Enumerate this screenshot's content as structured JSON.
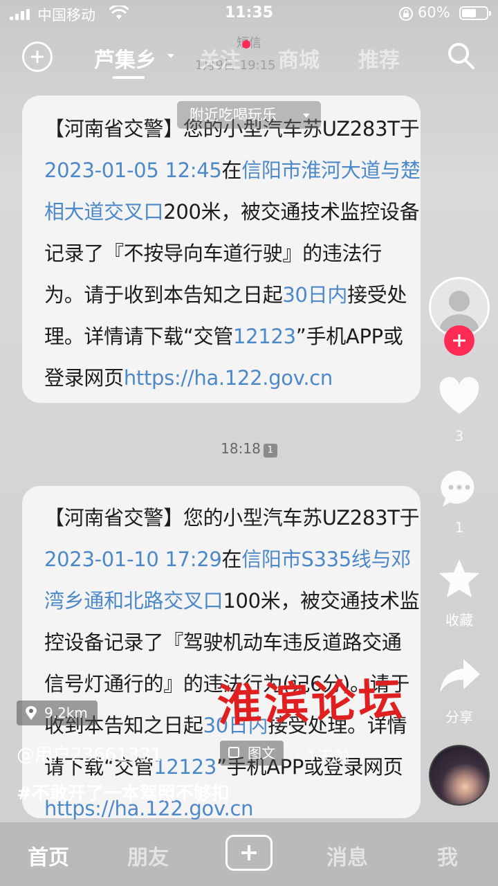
{
  "status_bar": {
    "carrier": "中国移动",
    "time": "11:35",
    "battery_pct": "60%",
    "battery_level": 0.6
  },
  "top_nav": {
    "location_tab": "芦集乡",
    "tabs": [
      "关注",
      "商城",
      "推荐"
    ]
  },
  "sms_header": {
    "title": "短信",
    "date": "1月9日 19:15"
  },
  "nearby_pill": "附近吃喝玩乐",
  "message1": {
    "parts": [
      {
        "text": "【河南省交警】您的小型汽车苏UZ283T于",
        "link": false
      },
      {
        "text": "2023-01-05 12:45",
        "link": true
      },
      {
        "text": "在",
        "link": false
      },
      {
        "text": "信阳市淮河大道与楚相大道交叉口",
        "link": true
      },
      {
        "text": "200米，被交通技术监控设备记录了『不按导向车道行驶』的违法行为。请于收到本告知之日起",
        "link": false
      },
      {
        "text": "30日内",
        "link": true
      },
      {
        "text": "接受处理。详情请下载“交管",
        "link": false
      },
      {
        "text": "12123",
        "link": true
      },
      {
        "text": "”手机APP或登录网页",
        "link": false
      },
      {
        "text": "https://ha.122.gov.cn",
        "link": true
      }
    ]
  },
  "timestamp": "18:18",
  "sim_badge": "1",
  "message2": {
    "parts": [
      {
        "text": "【河南省交警】您的小型汽车苏UZ283T于",
        "link": false
      },
      {
        "text": "2023-01-10 17:29",
        "link": true
      },
      {
        "text": "在",
        "link": false
      },
      {
        "text": "信阳市S335线与邓湾乡通和北路交叉口",
        "link": true
      },
      {
        "text": "100米，被交通技术监控设备记录了『驾驶机动车违反道路交通信号灯通行的』的违法行为(记6分)。请于收到本告知之日起",
        "link": false
      },
      {
        "text": "30日内",
        "link": true
      },
      {
        "text": "接受处理。详情请下载“交管",
        "link": false
      },
      {
        "text": "12123",
        "link": true
      },
      {
        "text": "”手机APP或登录网页",
        "link": false
      },
      {
        "text": "https://ha.122.gov.cn",
        "link": true
      }
    ]
  },
  "side_rail": {
    "like_count": "3",
    "comment_count": "1",
    "favorite_label": "收藏",
    "share_label": "分享"
  },
  "watermark": "淮滨论坛",
  "post": {
    "distance": "9.2km",
    "author": "@用户23661331",
    "type_badge": "图文",
    "time_ago": "· 1天前",
    "caption": "#不敢开了一本驾照不够扣"
  },
  "bottom_nav": {
    "home": "首页",
    "friends": "朋友",
    "messages": "消息",
    "me": "我"
  },
  "colors": {
    "link": "#4d88c8",
    "accent": "#fe2c55",
    "watermark": "#e02020"
  }
}
